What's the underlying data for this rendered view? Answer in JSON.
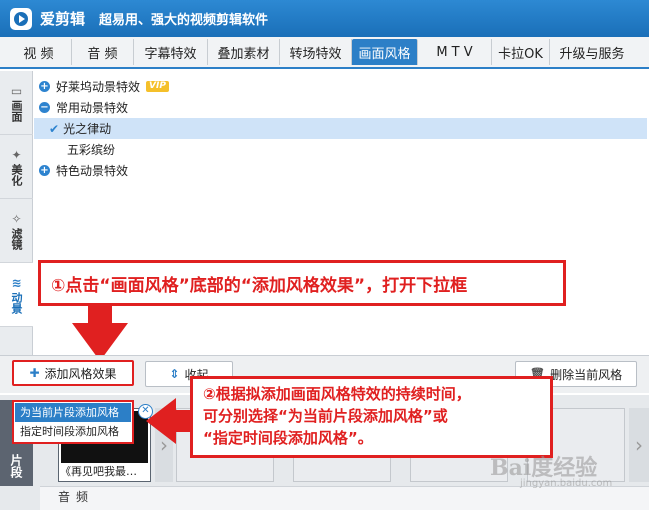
{
  "titlebar": {
    "app_name": "爱剪辑",
    "slogan": "超易用、强大的视频剪辑软件"
  },
  "tabs": [
    {
      "label": "视  频"
    },
    {
      "label": "音  频"
    },
    {
      "label": "字幕特效"
    },
    {
      "label": "叠加素材"
    },
    {
      "label": "转场特效"
    },
    {
      "label": "画面风格",
      "active": true
    },
    {
      "label": "M T V"
    },
    {
      "label": "卡拉OK"
    },
    {
      "label": "升级与服务"
    }
  ],
  "sidebar": [
    {
      "label": "画面",
      "icon": "picture-icon"
    },
    {
      "label": "美化",
      "icon": "wand-icon"
    },
    {
      "label": "滤镜",
      "icon": "filter-icon"
    },
    {
      "label": "动景",
      "icon": "wave-icon"
    }
  ],
  "tree": {
    "groups": [
      {
        "label": "好莱坞动景特效",
        "vip": "VIP",
        "expanded": false
      },
      {
        "label": "常用动景特效",
        "expanded": true,
        "items": [
          {
            "label": "光之律动",
            "selected": true
          },
          {
            "label": "五彩缤纷"
          }
        ]
      },
      {
        "label": "特色动景特效",
        "expanded": false
      }
    ]
  },
  "toolbar": {
    "add_label": "添加风格效果",
    "collapse_label": "收起",
    "delete_label": "删除当前风格"
  },
  "dropdown": {
    "items": [
      "为当前片段添加风格",
      "指定时间段添加风格"
    ]
  },
  "timeline": {
    "side_label": "片段",
    "clip_label": "《再见吧我最…",
    "audio_label": "音频"
  },
  "annotations": {
    "step1": "①点击“画面风格”底部的“添加风格效果”，打开下拉框",
    "step2_line1": "②根据拟添加画面风格特效的持续时间，",
    "step2_line2": "可分别选择“为当前片段添加风格”或",
    "step2_line3": "“指定时间段添加风格”。"
  },
  "watermark": {
    "text": "Bai度经验",
    "sub": "jingyan.baidu.com"
  },
  "colors": {
    "accent": "#2c7fc7",
    "annotation": "#e02020"
  }
}
